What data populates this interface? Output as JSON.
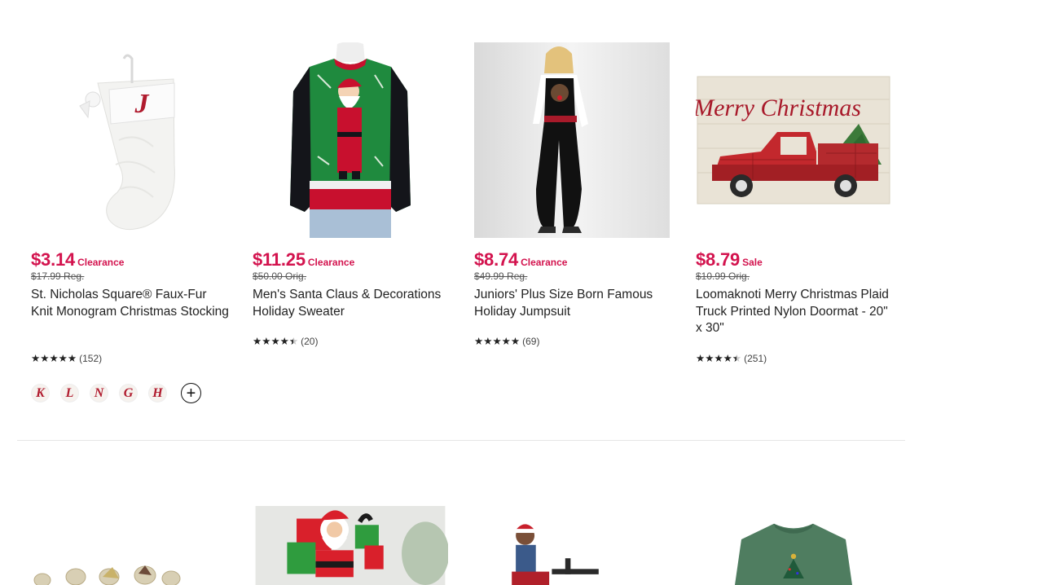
{
  "products": [
    {
      "price": "$3.14",
      "badge": "Clearance",
      "original_price": "$17.99 Reg.",
      "title": "St. Nicholas Square® Faux-Fur Knit Monogram Christmas Stocking",
      "rating_value": 5,
      "rating_count": "(152)",
      "swatches": [
        "K",
        "L",
        "N",
        "G",
        "H"
      ],
      "image": "white-knit-monogram-stocking-letter-J"
    },
    {
      "price": "$11.25",
      "badge": "Clearance",
      "original_price": "$50.00 Orig.",
      "title": "Men's Santa Claus & Decorations Holiday Sweater",
      "rating_value": 4.5,
      "rating_count": "(20)",
      "image": "green-santa-holiday-sweater"
    },
    {
      "price": "$8.74",
      "badge": "Clearance",
      "original_price": "$49.99 Reg.",
      "title": "Juniors' Plus Size Born Famous Holiday Jumpsuit",
      "rating_value": 5,
      "rating_count": "(69)",
      "image": "black-velvet-reindeer-jumpsuit"
    },
    {
      "price": "$8.79",
      "badge": "Sale",
      "original_price": "$10.99 Orig.",
      "title": "Loomaknoti Merry Christmas Plaid Truck Printed Nylon Doormat - 20\" x 30\"",
      "rating_value": 4.5,
      "rating_count": "(251)",
      "image": "merry-christmas-red-truck-doormat",
      "image_text": "Merry Christmas"
    }
  ],
  "next_row_images": [
    "nativity-figurines",
    "santa-gift-decoration",
    "child-figurine-red-hat",
    "green-christmas-tree-sweatshirt"
  ],
  "colors": {
    "price_accent": "#d3134e",
    "divider": "#e5e5e5"
  }
}
